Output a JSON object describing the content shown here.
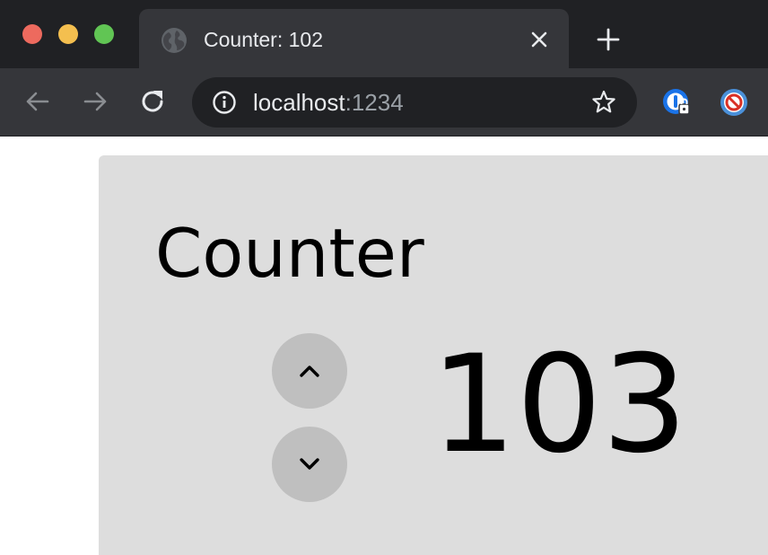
{
  "browser": {
    "tab": {
      "title": "Counter: 102"
    },
    "address_bar": {
      "host": "localhost",
      "port": ":1234"
    },
    "icons": {
      "window_controls": [
        "close-window",
        "minimize-window",
        "zoom-window"
      ],
      "tab": [
        "globe-icon",
        "close-tab-icon"
      ],
      "new_tab": "plus-icon",
      "toolbar": [
        "back-arrow-icon",
        "forward-arrow-icon",
        "reload-icon",
        "info-icon",
        "star-icon"
      ],
      "extensions": [
        "password-manager-extension-icon",
        "blocker-extension-icon"
      ]
    },
    "colors": {
      "tab_strip": "#202124",
      "toolbar": "#35363a",
      "traffic_red": "#ed6a5e",
      "traffic_yellow": "#f4bf4f",
      "traffic_green": "#61c554"
    }
  },
  "page": {
    "heading": "Counter",
    "counter_value": "103",
    "controls": {
      "increment_icon": "chevron-up-icon",
      "decrement_icon": "chevron-down-icon"
    },
    "colors": {
      "card_background": "#dddddd",
      "button_background": "#bfbfbf"
    }
  }
}
